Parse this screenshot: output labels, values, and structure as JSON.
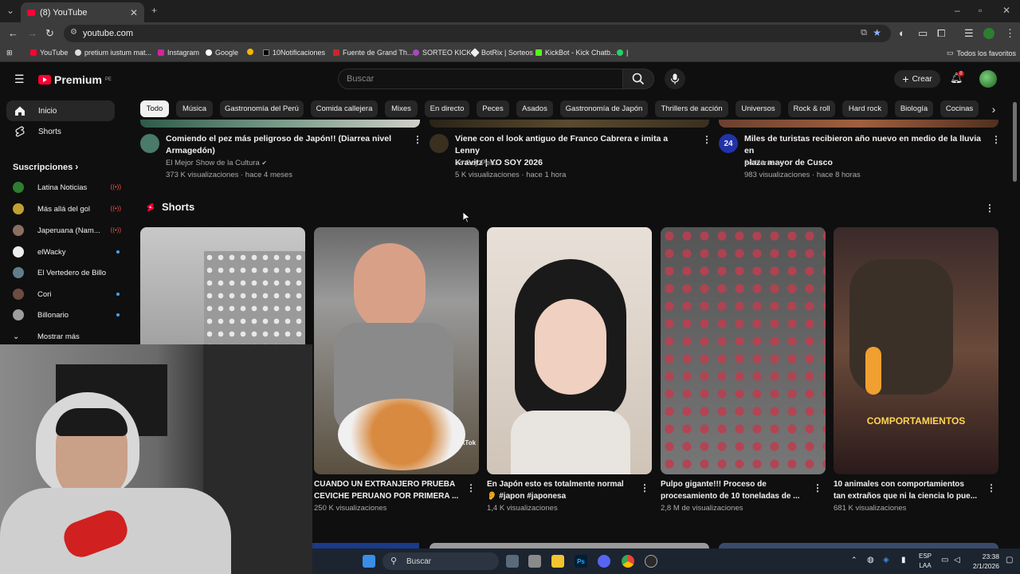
{
  "browser": {
    "tab_title": "(8) YouTube",
    "new_tab": "+",
    "url": "youtube.com",
    "bookmarks": [
      "YouTube",
      "pretium iustum mat...",
      "Instagram",
      "Google",
      "10Notificaciones",
      "Fuente de Grand Th...",
      "SORTEO KICK",
      "BotRix | Sorteos",
      "KickBot - Kick Chatb...",
      "|"
    ],
    "all_bookmarks": "Todos los favoritos"
  },
  "header": {
    "logo": "Premium",
    "logo_region": "PE",
    "search_placeholder": "Buscar",
    "create_label": "Crear",
    "notification_count": "8"
  },
  "chips": [
    "Todo",
    "Música",
    "Gastronomía del Perú",
    "Comida callejera",
    "Mixes",
    "En directo",
    "Peces",
    "Asados",
    "Gastronomía de Japón",
    "Thrillers de acción",
    "Universos",
    "Rock & roll",
    "Hard rock",
    "Biología",
    "Cocinas"
  ],
  "sidebar": {
    "items": [
      {
        "label": "Inicio",
        "icon": "home-icon"
      },
      {
        "label": "Shorts",
        "icon": "shorts-icon"
      }
    ],
    "subs_heading": "Suscripciones",
    "subscriptions": [
      {
        "name": "Latina Noticias",
        "status": "live",
        "color": "#2e7d32"
      },
      {
        "name": "Más allá del gol",
        "status": "live",
        "color": "#c0a030"
      },
      {
        "name": "Japeruana (Nam...",
        "status": "live",
        "color": "#8d6e63"
      },
      {
        "name": "elWacky",
        "status": "new",
        "color": "#eeeeee"
      },
      {
        "name": "El Vertedero de Billo",
        "status": "",
        "color": "#607d8b"
      },
      {
        "name": "Cori",
        "status": "new",
        "color": "#6d4c41"
      },
      {
        "name": "Billonario",
        "status": "new",
        "color": "#9e9e9e"
      }
    ],
    "show_more": "Mostrar más"
  },
  "videos": [
    {
      "title_line1": "Comiendo el pez más peligroso de Japón!! (Diarrea nivel",
      "title_line2": "Armagedón)",
      "channel": "El Mejor Show de la Cultura",
      "meta": "373 K visualizaciones · hace 4 meses",
      "color": "#4a7a6a"
    },
    {
      "title_line1": "Viene con el look antiguo de Franco Cabrera e imita a Lenny",
      "title_line2": "Kravitz | YO SOY 2026",
      "channel": "Yo Soy Perú",
      "meta": "5 K visualizaciones · hace 1 hora",
      "color": "#3a3020"
    },
    {
      "title_line1": "Miles de turistas recibieron año nuevo en medio de la lluvia en",
      "title_line2": "plaza mayor de Cusco",
      "channel": "24 Horas",
      "meta": "983 visualizaciones · hace 8 horas",
      "color": "#2233aa",
      "avatar_text": "24"
    }
  ],
  "shorts": {
    "heading": "Shorts",
    "items": [
      {
        "title_line1": "",
        "title_line2": "",
        "views": ""
      },
      {
        "title_line1": "CUANDO UN EXTRANJERO PRUEBA",
        "title_line2": "CEVICHE PERUANO POR PRIMERA ...",
        "views": "250 K visualizaciones",
        "overlay": "TikTok"
      },
      {
        "title_line1": "En Japón esto es totalmente normal",
        "title_line2": "👂 #japon #japonesa",
        "views": "1,4 K visualizaciones"
      },
      {
        "title_line1": "Pulpo gigante!!! Proceso de",
        "title_line2": "procesamiento de 10 toneladas de ...",
        "views": "2,8 M de visualizaciones"
      },
      {
        "title_line1": "10 animales con comportamientos",
        "title_line2": "tan extraños que ni la ciencia lo pue...",
        "views": "681 K visualizaciones",
        "overlay": "COMPORTAMIENTOS"
      }
    ]
  },
  "taskbar": {
    "search": "Buscar",
    "lang_line1": "ESP",
    "lang_line2": "LAA",
    "time": "23:38",
    "date": "2/1/2026"
  },
  "colors": {
    "accent": "#ff0033",
    "bg": "#0f0f0f",
    "chip": "#272727",
    "link": "#3ea6ff"
  }
}
